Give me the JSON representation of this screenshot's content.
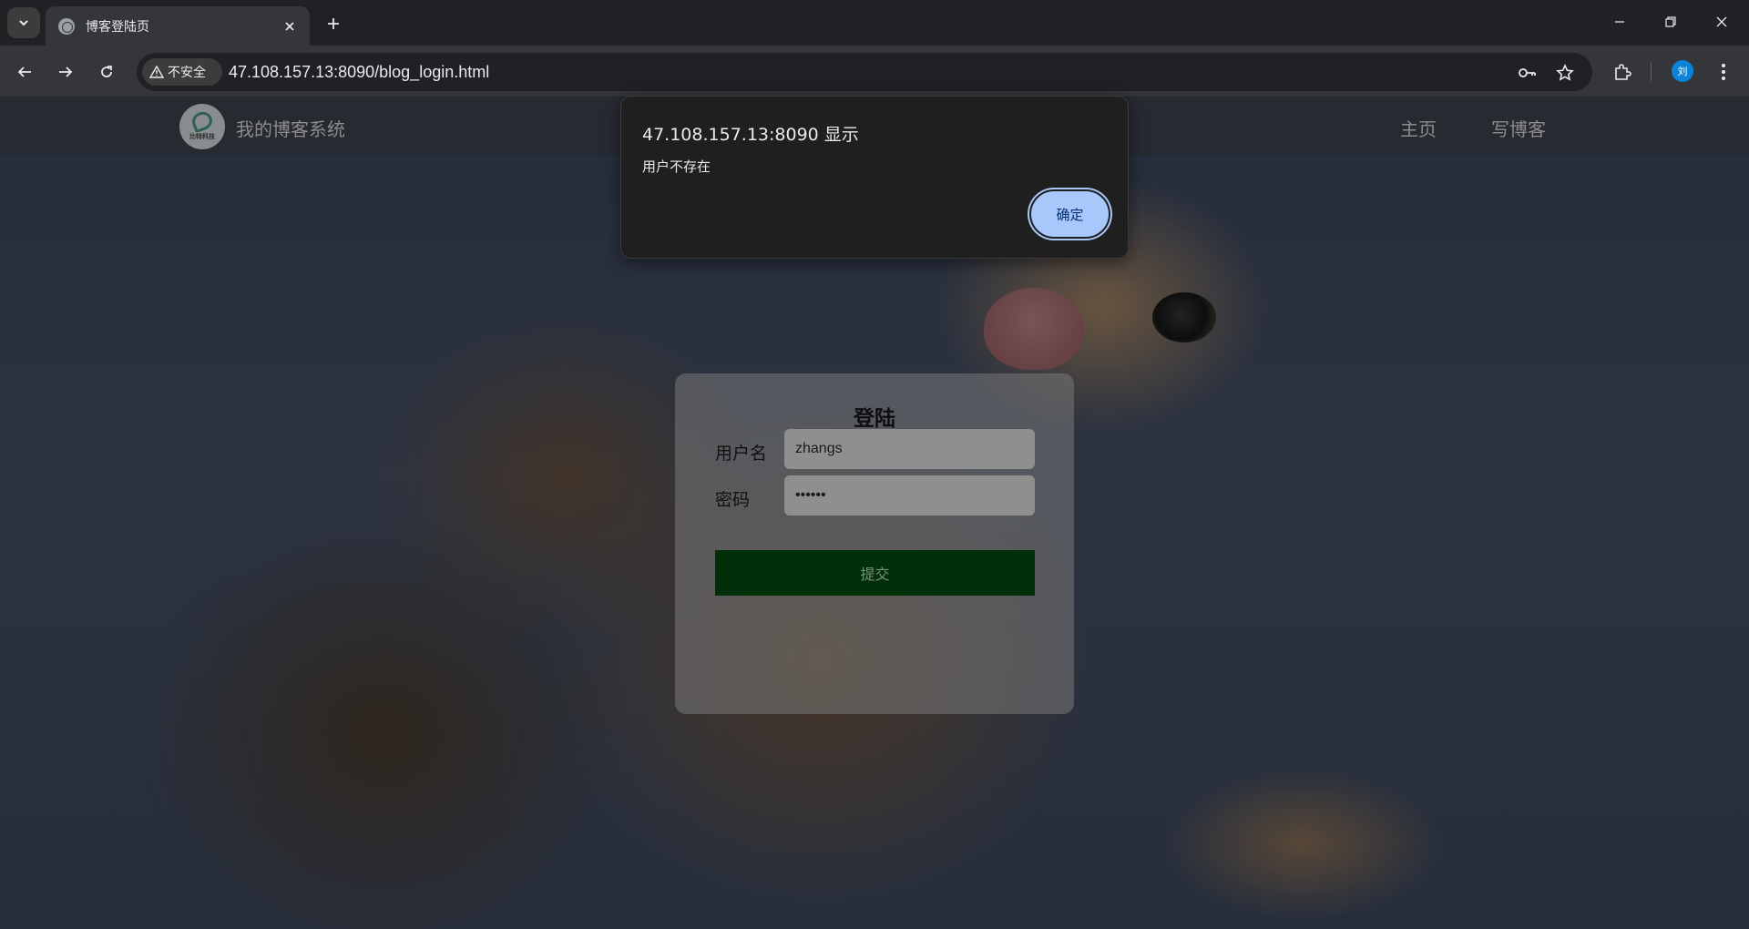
{
  "browser": {
    "tab_title": "博客登陆页",
    "security_label": "不安全",
    "url": "47.108.157.13:8090/blog_login.html",
    "avatar_initial": "刘"
  },
  "header": {
    "logo_text": "比特科技",
    "site_title": "我的博客系统",
    "nav": [
      "主页",
      "写博客"
    ]
  },
  "login": {
    "title": "登陆",
    "username_label": "用户名",
    "username_value": "zhangs",
    "password_label": "密码",
    "password_value": "••••••",
    "submit_label": "提交"
  },
  "alert": {
    "title": "47.108.157.13:8090 显示",
    "message": "用户不存在",
    "ok_label": "确定"
  }
}
